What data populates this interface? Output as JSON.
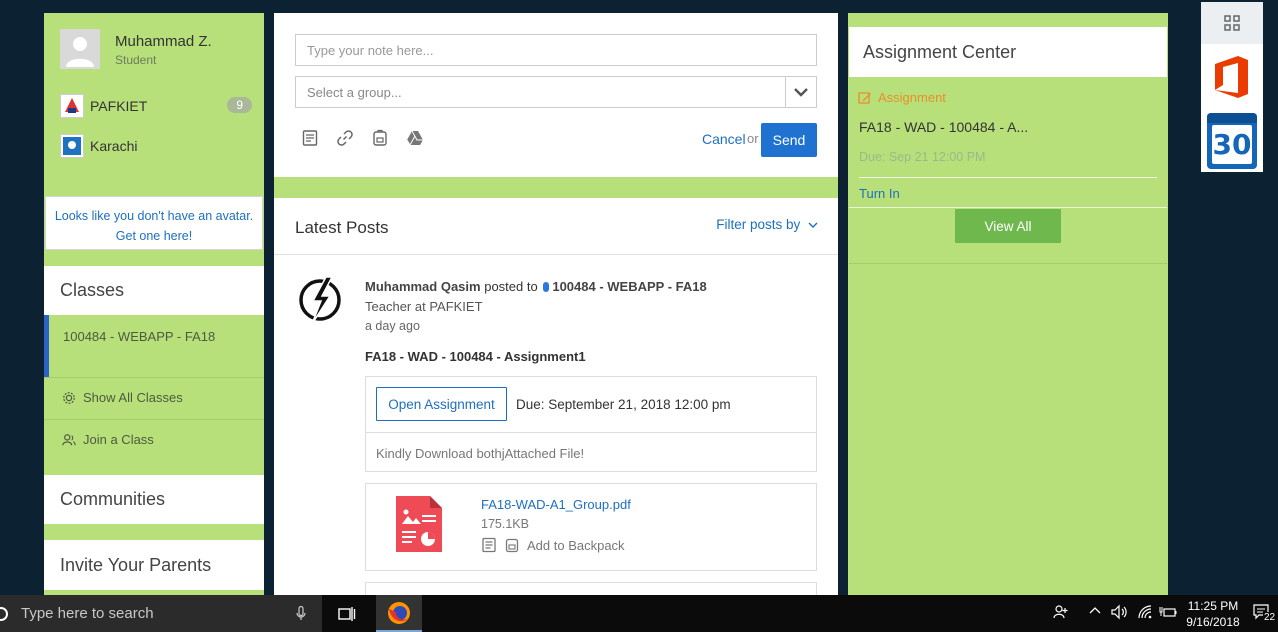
{
  "profile": {
    "name": "Muhammad Z.",
    "role": "Student",
    "schools": [
      {
        "label": "PAFKIET",
        "badge": "9"
      },
      {
        "label": "Karachi"
      }
    ],
    "avatar_note": "Looks like you don't have an avatar. Get one here!"
  },
  "classes": {
    "heading": "Classes",
    "items": [
      {
        "label": "100484 - WEBAPP - FA18"
      }
    ],
    "show_all": "Show All Classes",
    "join": "Join a Class"
  },
  "communities": {
    "heading": "Communities"
  },
  "invite": {
    "heading": "Invite Your Parents"
  },
  "composer": {
    "note_placeholder": "Type your note here...",
    "group_placeholder": "Select a group...",
    "tool_icons": [
      "note-icon",
      "link-icon",
      "backpack-icon",
      "google-drive-icon"
    ],
    "cancel": "Cancel",
    "or": "or",
    "send": "Send"
  },
  "posts": {
    "title": "Latest Posts",
    "filter": "Filter posts by",
    "items": [
      {
        "author": "Muhammad Qasim",
        "posted_to": "posted to",
        "group": "100484 - WEBAPP - FA18",
        "author_role": "Teacher at PAFKIET",
        "time": "a day ago",
        "title": "FA18 - WAD - 100484 - Assignment1",
        "open_button": "Open Assignment",
        "due": "Due: September 21, 2018 12:00 pm",
        "description": "Kindly Download bothjAttached File!",
        "file": {
          "name": "FA18-WAD-A1_Group.pdf",
          "size": "175.1KB",
          "backpack": "Add to Backpack"
        }
      }
    ]
  },
  "assignment_center": {
    "heading": "Assignment Center",
    "tag": "Assignment",
    "title": "FA18 - WAD - 100484 - A...",
    "due": "Due: Sep 21 12:00 PM",
    "turn_in": "Turn In",
    "view_all": "View All"
  },
  "app_strip": {
    "calendar_day": "30"
  },
  "taskbar": {
    "search_placeholder": "Type here to search",
    "time": "11:25 PM",
    "date": "9/16/2018",
    "notifications": "22"
  },
  "colors": {
    "panel_green": "#b8e07a",
    "link_blue": "#1f6fbf",
    "send_blue": "#1f72cf",
    "view_all_green": "#6fb84e",
    "assignment_orange": "#e8902a",
    "class_accent": "#2b63c6"
  }
}
